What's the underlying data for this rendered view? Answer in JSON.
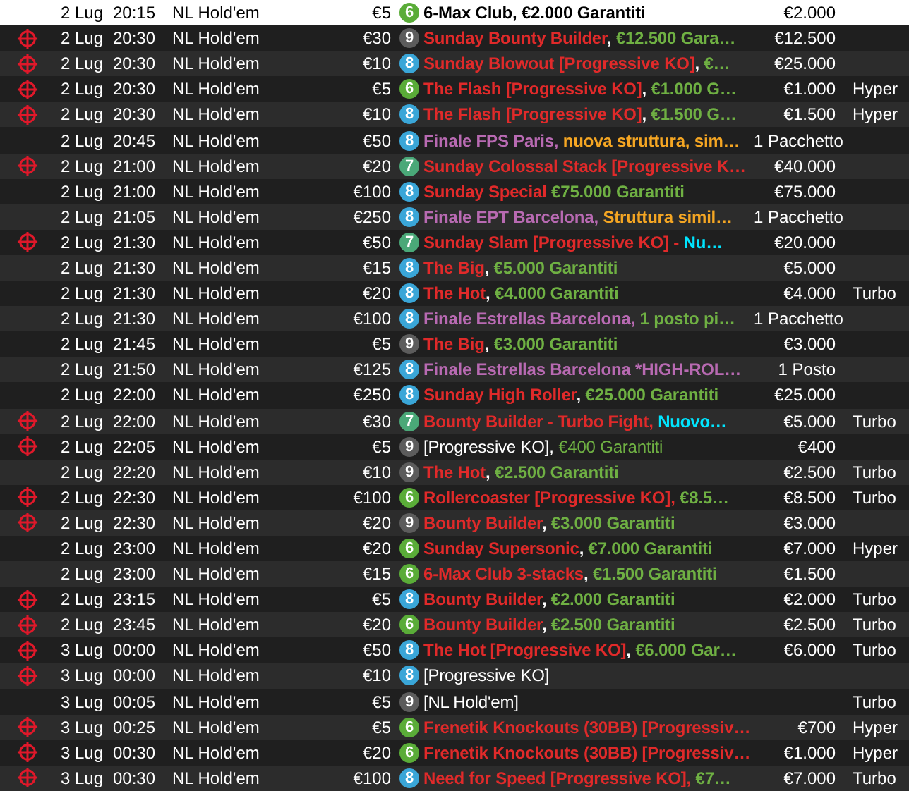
{
  "rows": [
    {
      "selected": true,
      "target": false,
      "date": "2 Lug",
      "time": "20:15",
      "game": "NL Hold'em",
      "buyin": "€5",
      "badge": {
        "text": "6",
        "color": "#5aac38"
      },
      "bold": true,
      "name": [
        {
          "text": "6-Max Club, €2.000 Garantiti",
          "color": "#000000"
        }
      ],
      "prize": "€2.000"
    },
    {
      "selected": false,
      "target": true,
      "date": "2 Lug",
      "time": "20:30",
      "game": "NL Hold'em",
      "buyin": "€30",
      "badge": {
        "text": "9",
        "color": "#5c5c5c"
      },
      "bold": true,
      "name": [
        {
          "text": "Sunday Bounty Builder",
          "color": "#e02a2a"
        },
        {
          "text": ", ",
          "color": "#ffffff"
        },
        {
          "text": "€12.500 Gara…",
          "color": "#6fb043"
        }
      ],
      "prize": "€12.500"
    },
    {
      "selected": false,
      "target": true,
      "date": "2 Lug",
      "time": "20:30",
      "game": "NL Hold'em",
      "buyin": "€10",
      "badge": {
        "text": "8",
        "color": "#3aa6d8"
      },
      "bold": true,
      "name": [
        {
          "text": "Sunday Blowout [Progressive KO]",
          "color": "#e02a2a"
        },
        {
          "text": ", ",
          "color": "#ffffff"
        },
        {
          "text": "€…",
          "color": "#6fb043"
        }
      ],
      "prize": "€25.000"
    },
    {
      "selected": false,
      "target": true,
      "date": "2 Lug",
      "time": "20:30",
      "game": "NL Hold'em",
      "buyin": "€5",
      "badge": {
        "text": "6",
        "color": "#5aac38"
      },
      "bold": true,
      "name": [
        {
          "text": "The Flash [Progressive KO]",
          "color": "#e02a2a"
        },
        {
          "text": ", ",
          "color": "#ffffff"
        },
        {
          "text": "€1.000 G…",
          "color": "#6fb043"
        }
      ],
      "prize": "€1.000",
      "speed": "Hyper"
    },
    {
      "selected": false,
      "target": true,
      "date": "2 Lug",
      "time": "20:30",
      "game": "NL Hold'em",
      "buyin": "€10",
      "badge": {
        "text": "8",
        "color": "#3aa6d8"
      },
      "bold": true,
      "name": [
        {
          "text": "The Flash [Progressive KO]",
          "color": "#e02a2a"
        },
        {
          "text": ", ",
          "color": "#ffffff"
        },
        {
          "text": "€1.500 G…",
          "color": "#6fb043"
        }
      ],
      "prize": "€1.500",
      "speed": "Hyper"
    },
    {
      "selected": false,
      "target": false,
      "date": "2 Lug",
      "time": "20:45",
      "game": "NL Hold'em",
      "buyin": "€50",
      "badge": {
        "text": "8",
        "color": "#3aa6d8"
      },
      "bold": true,
      "name": [
        {
          "text": "Finale FPS Paris, ",
          "color": "#b86ab2"
        },
        {
          "text": "nuova struttura, sim…",
          "color": "#f5a623"
        }
      ],
      "prize": "1 Pacchetto"
    },
    {
      "selected": false,
      "target": true,
      "date": "2 Lug",
      "time": "21:00",
      "game": "NL Hold'em",
      "buyin": "€20",
      "badge": {
        "text": "7",
        "color": "#4aa878"
      },
      "bold": true,
      "name": [
        {
          "text": "Sunday Colossal Stack [Progressive K…",
          "color": "#e02a2a"
        }
      ],
      "prize": "€40.000"
    },
    {
      "selected": false,
      "target": false,
      "date": "2 Lug",
      "time": "21:00",
      "game": "NL Hold'em",
      "buyin": "€100",
      "badge": {
        "text": "8",
        "color": "#3aa6d8"
      },
      "bold": true,
      "name": [
        {
          "text": "Sunday Special ",
          "color": "#e02a2a"
        },
        {
          "text": "€75.000 Garantiti",
          "color": "#6fb043"
        }
      ],
      "prize": "€75.000"
    },
    {
      "selected": false,
      "target": false,
      "date": "2 Lug",
      "time": "21:05",
      "game": "NL Hold'em",
      "buyin": "€250",
      "badge": {
        "text": "8",
        "color": "#3aa6d8"
      },
      "bold": true,
      "name": [
        {
          "text": "Finale EPT Barcelona, ",
          "color": "#b86ab2"
        },
        {
          "text": "Struttura simil…",
          "color": "#f5a623"
        }
      ],
      "prize": "1 Pacchetto"
    },
    {
      "selected": false,
      "target": true,
      "date": "2 Lug",
      "time": "21:30",
      "game": "NL Hold'em",
      "buyin": "€50",
      "badge": {
        "text": "7",
        "color": "#4aa878"
      },
      "bold": true,
      "name": [
        {
          "text": "Sunday Slam [Progressive KO] - ",
          "color": "#e02a2a"
        },
        {
          "text": "Nu…",
          "color": "#00e5ff"
        }
      ],
      "prize": "€20.000"
    },
    {
      "selected": false,
      "target": false,
      "date": "2 Lug",
      "time": "21:30",
      "game": "NL Hold'em",
      "buyin": "€15",
      "badge": {
        "text": "8",
        "color": "#3aa6d8"
      },
      "bold": true,
      "name": [
        {
          "text": "The Big",
          "color": "#e02a2a"
        },
        {
          "text": ", ",
          "color": "#ffffff"
        },
        {
          "text": "€5.000 Garantiti",
          "color": "#6fb043"
        }
      ],
      "prize": "€5.000"
    },
    {
      "selected": false,
      "target": false,
      "date": "2 Lug",
      "time": "21:30",
      "game": "NL Hold'em",
      "buyin": "€20",
      "badge": {
        "text": "8",
        "color": "#3aa6d8"
      },
      "bold": true,
      "name": [
        {
          "text": "The Hot",
          "color": "#e02a2a"
        },
        {
          "text": ", ",
          "color": "#ffffff"
        },
        {
          "text": "€4.000 Garantiti",
          "color": "#6fb043"
        }
      ],
      "prize": "€4.000",
      "speed": "Turbo"
    },
    {
      "selected": false,
      "target": false,
      "date": "2 Lug",
      "time": "21:30",
      "game": "NL Hold'em",
      "buyin": "€100",
      "badge": {
        "text": "8",
        "color": "#3aa6d8"
      },
      "bold": true,
      "name": [
        {
          "text": "Finale Estrellas Barcelona, ",
          "color": "#b86ab2"
        },
        {
          "text": "1 posto pi…",
          "color": "#6fb043"
        }
      ],
      "prize": "1 Pacchetto"
    },
    {
      "selected": false,
      "target": false,
      "date": "2 Lug",
      "time": "21:45",
      "game": "NL Hold'em",
      "buyin": "€5",
      "badge": {
        "text": "9",
        "color": "#5c5c5c"
      },
      "bold": true,
      "name": [
        {
          "text": "The Big",
          "color": "#e02a2a"
        },
        {
          "text": ", ",
          "color": "#ffffff"
        },
        {
          "text": "€3.000 Garantiti",
          "color": "#6fb043"
        }
      ],
      "prize": "€3.000"
    },
    {
      "selected": false,
      "target": false,
      "date": "2 Lug",
      "time": "21:50",
      "game": "NL Hold'em",
      "buyin": "€125",
      "badge": {
        "text": "8",
        "color": "#3aa6d8"
      },
      "bold": true,
      "name": [
        {
          "text": "Finale Estrellas Barcelona *HIGH-ROL…",
          "color": "#b86ab2"
        }
      ],
      "prize": "1 Posto"
    },
    {
      "selected": false,
      "target": false,
      "date": "2 Lug",
      "time": "22:00",
      "game": "NL Hold'em",
      "buyin": "€250",
      "badge": {
        "text": "8",
        "color": "#3aa6d8"
      },
      "bold": true,
      "name": [
        {
          "text": "Sunday High Roller",
          "color": "#e02a2a"
        },
        {
          "text": ", ",
          "color": "#ffffff"
        },
        {
          "text": "€25.000 Garantiti",
          "color": "#6fb043"
        }
      ],
      "prize": "€25.000"
    },
    {
      "selected": false,
      "target": true,
      "date": "2 Lug",
      "time": "22:00",
      "game": "NL Hold'em",
      "buyin": "€30",
      "badge": {
        "text": "7",
        "color": "#4aa878"
      },
      "bold": true,
      "name": [
        {
          "text": "Bounty Builder - Turbo Fight, ",
          "color": "#e02a2a"
        },
        {
          "text": "Nuovo…",
          "color": "#00e5ff"
        }
      ],
      "prize": "€5.000",
      "speed": "Turbo"
    },
    {
      "selected": false,
      "target": true,
      "date": "2 Lug",
      "time": "22:05",
      "game": "NL Hold'em",
      "buyin": "€5",
      "badge": {
        "text": "9",
        "color": "#5c5c5c"
      },
      "bold": false,
      "name": [
        {
          "text": "[Progressive KO], ",
          "color": "#ffffff"
        },
        {
          "text": "€400 Garantiti",
          "color": "#6fb043"
        }
      ],
      "prize": "€400"
    },
    {
      "selected": false,
      "target": false,
      "date": "2 Lug",
      "time": "22:20",
      "game": "NL Hold'em",
      "buyin": "€10",
      "badge": {
        "text": "9",
        "color": "#5c5c5c"
      },
      "bold": true,
      "name": [
        {
          "text": "The Hot",
          "color": "#e02a2a"
        },
        {
          "text": ", ",
          "color": "#ffffff"
        },
        {
          "text": "€2.500 Garantiti",
          "color": "#6fb043"
        }
      ],
      "prize": "€2.500",
      "speed": "Turbo"
    },
    {
      "selected": false,
      "target": true,
      "date": "2 Lug",
      "time": "22:30",
      "game": "NL Hold'em",
      "buyin": "€100",
      "badge": {
        "text": "6",
        "color": "#5aac38"
      },
      "bold": true,
      "name": [
        {
          "text": "Rollercoaster [Progressive KO], ",
          "color": "#e02a2a"
        },
        {
          "text": "€8.5…",
          "color": "#6fb043"
        }
      ],
      "prize": "€8.500",
      "speed": "Turbo"
    },
    {
      "selected": false,
      "target": true,
      "date": "2 Lug",
      "time": "22:30",
      "game": "NL Hold'em",
      "buyin": "€20",
      "badge": {
        "text": "9",
        "color": "#5c5c5c"
      },
      "bold": true,
      "name": [
        {
          "text": "Bounty Builder",
          "color": "#e02a2a"
        },
        {
          "text": ", ",
          "color": "#ffffff"
        },
        {
          "text": "€3.000 Garantiti",
          "color": "#6fb043"
        }
      ],
      "prize": "€3.000"
    },
    {
      "selected": false,
      "target": false,
      "date": "2 Lug",
      "time": "23:00",
      "game": "NL Hold'em",
      "buyin": "€20",
      "badge": {
        "text": "6",
        "color": "#5aac38"
      },
      "bold": true,
      "name": [
        {
          "text": "Sunday Supersonic",
          "color": "#e02a2a"
        },
        {
          "text": ", ",
          "color": "#ffffff"
        },
        {
          "text": "€7.000 Garantiti",
          "color": "#6fb043"
        }
      ],
      "prize": "€7.000",
      "speed": "Hyper"
    },
    {
      "selected": false,
      "target": false,
      "date": "2 Lug",
      "time": "23:00",
      "game": "NL Hold'em",
      "buyin": "€15",
      "badge": {
        "text": "6",
        "color": "#5aac38"
      },
      "bold": true,
      "name": [
        {
          "text": "6-Max Club 3-stacks",
          "color": "#e02a2a"
        },
        {
          "text": ", ",
          "color": "#ffffff"
        },
        {
          "text": "€1.500 Garantiti",
          "color": "#6fb043"
        }
      ],
      "prize": "€1.500"
    },
    {
      "selected": false,
      "target": true,
      "date": "2 Lug",
      "time": "23:15",
      "game": "NL Hold'em",
      "buyin": "€5",
      "badge": {
        "text": "8",
        "color": "#3aa6d8"
      },
      "bold": true,
      "name": [
        {
          "text": "Bounty Builder",
          "color": "#e02a2a"
        },
        {
          "text": ", ",
          "color": "#ffffff"
        },
        {
          "text": "€2.000 Garantiti",
          "color": "#6fb043"
        }
      ],
      "prize": "€2.000",
      "speed": "Turbo"
    },
    {
      "selected": false,
      "target": true,
      "date": "2 Lug",
      "time": "23:45",
      "game": "NL Hold'em",
      "buyin": "€20",
      "badge": {
        "text": "6",
        "color": "#5aac38"
      },
      "bold": true,
      "name": [
        {
          "text": "Bounty Builder",
          "color": "#e02a2a"
        },
        {
          "text": ", ",
          "color": "#ffffff"
        },
        {
          "text": "€2.500 Garantiti",
          "color": "#6fb043"
        }
      ],
      "prize": "€2.500",
      "speed": "Turbo"
    },
    {
      "selected": false,
      "target": true,
      "date": "3 Lug",
      "time": "00:00",
      "game": "NL Hold'em",
      "buyin": "€50",
      "badge": {
        "text": "8",
        "color": "#3aa6d8"
      },
      "bold": true,
      "name": [
        {
          "text": "The Hot [Progressive KO]",
          "color": "#e02a2a"
        },
        {
          "text": ", ",
          "color": "#ffffff"
        },
        {
          "text": "€6.000 Gar…",
          "color": "#6fb043"
        }
      ],
      "prize": "€6.000",
      "speed": "Turbo"
    },
    {
      "selected": false,
      "target": true,
      "date": "3 Lug",
      "time": "00:00",
      "game": "NL Hold'em",
      "buyin": "€10",
      "badge": {
        "text": "8",
        "color": "#3aa6d8"
      },
      "bold": false,
      "name": [
        {
          "text": "[Progressive KO]",
          "color": "#ffffff"
        }
      ]
    },
    {
      "selected": false,
      "target": false,
      "date": "3 Lug",
      "time": "00:05",
      "game": "NL Hold'em",
      "buyin": "€5",
      "badge": {
        "text": "9",
        "color": "#5c5c5c"
      },
      "bold": false,
      "name": [
        {
          "text": "[NL Hold'em]",
          "color": "#ffffff"
        }
      ],
      "speed": "Turbo"
    },
    {
      "selected": false,
      "target": true,
      "date": "3 Lug",
      "time": "00:25",
      "game": "NL Hold'em",
      "buyin": "€5",
      "badge": {
        "text": "6",
        "color": "#5aac38"
      },
      "bold": true,
      "name": [
        {
          "text": "Frenetik Knockouts (30BB) [Progressiv…",
          "color": "#e02a2a"
        }
      ],
      "prize": "€700",
      "speed": "Hyper"
    },
    {
      "selected": false,
      "target": true,
      "date": "3 Lug",
      "time": "00:30",
      "game": "NL Hold'em",
      "buyin": "€20",
      "badge": {
        "text": "6",
        "color": "#5aac38"
      },
      "bold": true,
      "name": [
        {
          "text": "Frenetik Knockouts (30BB) [Progressiv…",
          "color": "#e02a2a"
        }
      ],
      "prize": "€1.000",
      "speed": "Hyper"
    },
    {
      "selected": false,
      "target": true,
      "date": "3 Lug",
      "time": "00:30",
      "game": "NL Hold'em",
      "buyin": "€100",
      "badge": {
        "text": "8",
        "color": "#3aa6d8"
      },
      "bold": true,
      "name": [
        {
          "text": "Need for Speed [Progressive KO], ",
          "color": "#e02a2a"
        },
        {
          "text": "€7…",
          "color": "#6fb043"
        }
      ],
      "prize": "€7.000",
      "speed": "Turbo"
    }
  ]
}
